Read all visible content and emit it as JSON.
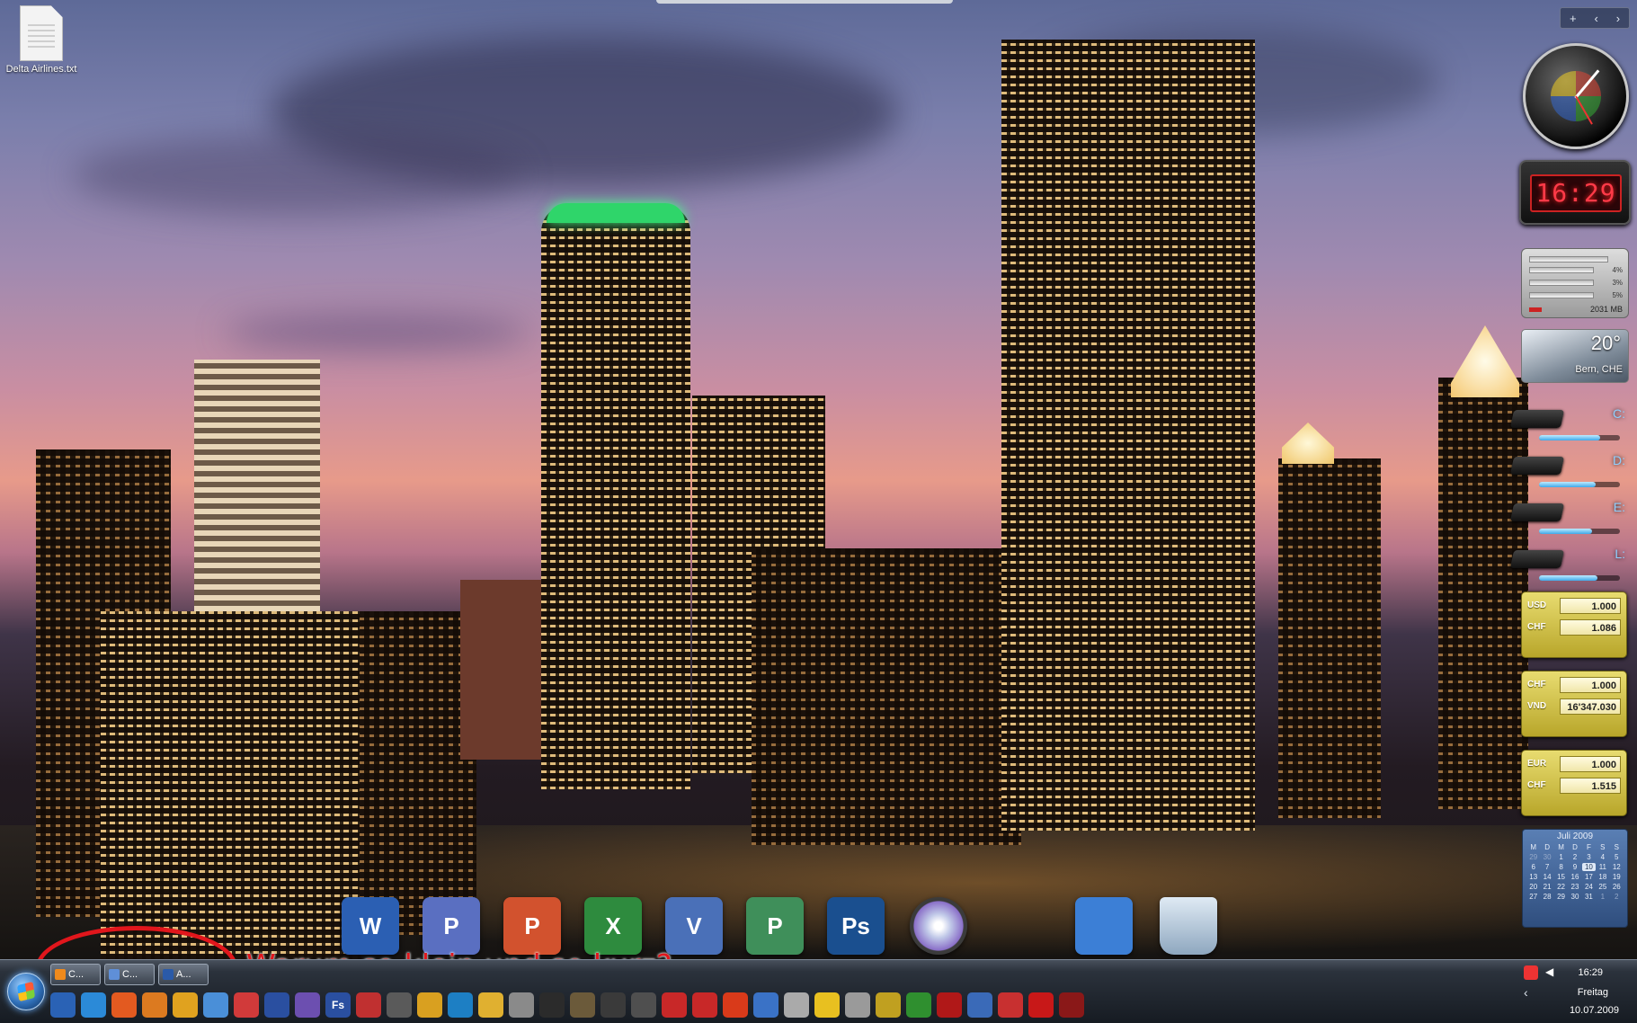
{
  "desktop": {
    "file_label": "Delta Airlines.txt"
  },
  "gadgets": {
    "digital_clock": "16:29",
    "cpu_meter": {
      "values": [
        "4%",
        "3%",
        "5%"
      ],
      "memory": "2031 MB"
    },
    "weather": {
      "temperature": "20°",
      "location": "Bern, CHE"
    },
    "drives": [
      {
        "letter": "C:",
        "usage": 0.75
      },
      {
        "letter": "D:",
        "usage": 0.7
      },
      {
        "letter": "E:",
        "usage": 0.65
      },
      {
        "letter": "L:",
        "usage": 0.72
      }
    ],
    "currency_converters": [
      {
        "from_code": "USD",
        "from_value": "1.000",
        "to_code": "CHF",
        "to_value": "1.086"
      },
      {
        "from_code": "CHF",
        "from_value": "1.000",
        "to_code": "VND",
        "to_value": "16'347.030"
      },
      {
        "from_code": "EUR",
        "from_value": "1.000",
        "to_code": "CHF",
        "to_value": "1.515"
      }
    ],
    "calendar": {
      "month": "Juli 2009",
      "weekdays": [
        "M",
        "D",
        "M",
        "D",
        "F",
        "S",
        "S"
      ],
      "days": [
        "29",
        "30",
        "1",
        "2",
        "3",
        "4",
        "5",
        "6",
        "7",
        "8",
        "9",
        "10",
        "11",
        "12",
        "13",
        "14",
        "15",
        "16",
        "17",
        "18",
        "19",
        "20",
        "21",
        "22",
        "23",
        "24",
        "25",
        "26",
        "27",
        "28",
        "29",
        "30",
        "31",
        "1",
        "2"
      ],
      "today": "10"
    }
  },
  "dock": {
    "items": [
      {
        "name": "word",
        "glyph": "W",
        "color": "#2b5fb3"
      },
      {
        "name": "publisher",
        "glyph": "P",
        "color": "#5a6fc1"
      },
      {
        "name": "powerpoint",
        "glyph": "P",
        "color": "#d2522e"
      },
      {
        "name": "excel",
        "glyph": "X",
        "color": "#2e8b3e"
      },
      {
        "name": "visio",
        "glyph": "V",
        "color": "#4a70b8"
      },
      {
        "name": "project",
        "glyph": "P",
        "color": "#3f8f5a"
      },
      {
        "name": "photoshop",
        "glyph": "Ps",
        "color": "#1a4f8f"
      },
      {
        "name": "dvd-maker",
        "glyph": "",
        "color": "#8c8c8c"
      },
      {
        "name": "desktop",
        "glyph": "",
        "color": "#3c7fd6"
      },
      {
        "name": "recycle-bin",
        "glyph": "",
        "color": "#9fb8cf"
      }
    ]
  },
  "annotation": {
    "text": "Warum so klein und so kurz?"
  },
  "taskbar": {
    "buttons": [
      {
        "label": "C...",
        "icon_color": "#f08a1c"
      },
      {
        "label": "C...",
        "icon_color": "#5f8fd8"
      },
      {
        "label": "A...",
        "icon_color": "#2a5aa8"
      }
    ],
    "quicklaunch": [
      "#2a62b5",
      "#2b8ad8",
      "#e35a20",
      "#dc7a20",
      "#e0a21f",
      "#4a8fd8",
      "#d13a3a",
      "#2a4fa0",
      "#6c4fb0",
      "#c0c0c0",
      "#c03030",
      "#5a5a5a",
      "#d9a020",
      "#1d7fc4",
      "#e0b030",
      "#8a8a8a",
      "#2b2b2b",
      "#6b5a3a",
      "#3a3a3a",
      "#4f4f4f",
      "#c82828",
      "#c82828",
      "#d93a1a",
      "#3a72c6",
      "#aaaaaa",
      "#e8c020",
      "#9a9a9a",
      "#c0a020",
      "#2f8f2f",
      "#b01818",
      "#3a6ab8",
      "#c83030",
      "#c81818",
      "#8a1818"
    ],
    "fs_label": "Fs",
    "tray": {
      "time": "16:29",
      "day": "Freitag",
      "date": "10.07.2009"
    }
  },
  "gadget_controls": {
    "add": "+",
    "prev": "‹",
    "next": "›"
  }
}
